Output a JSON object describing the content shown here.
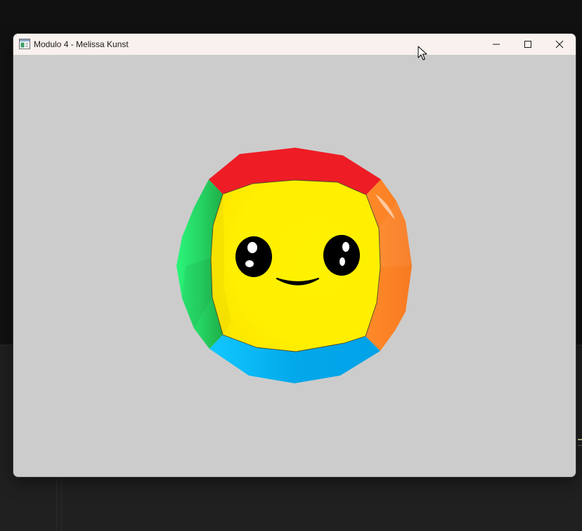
{
  "window": {
    "title": "Modulo 4 - Melissa Kunst",
    "controls": {
      "minimize_icon": "minimize-icon",
      "maximize_icon": "maximize-icon",
      "close_icon": "close-icon"
    }
  },
  "scene": {
    "background_color": "#cccccc",
    "object": "rainbow-faced-polyhedron",
    "colors": {
      "face": "#fff200",
      "top": "#ee1c25",
      "right": "#ff7f27",
      "bottom": "#00a2e8",
      "left": "#22b14c",
      "eyes": "#000000",
      "highlights": "#ffffff"
    }
  },
  "cursor": "arrow-cursor-icon"
}
